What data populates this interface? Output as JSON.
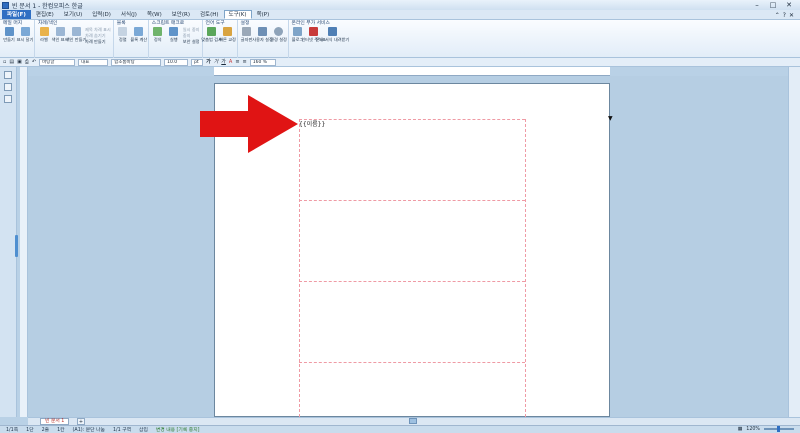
{
  "window": {
    "title": "빈 문서 1 - 한컴오피스 한글",
    "controls": [
      "–",
      "□",
      "✕"
    ]
  },
  "menu": {
    "items": [
      {
        "label": "파일(F)",
        "kind": "file"
      },
      {
        "label": "편집(E)"
      },
      {
        "label": "보기(U)"
      },
      {
        "label": "입력(D)"
      },
      {
        "label": "서식(J)"
      },
      {
        "label": "쪽(W)"
      },
      {
        "label": "보안(R)"
      },
      {
        "label": "검토(H)"
      },
      {
        "label": "도구(K)",
        "kind": "active"
      },
      {
        "label": "쪽(P)"
      }
    ],
    "right": [
      "⌃",
      "?",
      "✕"
    ]
  },
  "ribbon": {
    "groups": [
      {
        "title": "메일 머지",
        "buttons": [
          "만들기",
          "표시 달기"
        ]
      },
      {
        "title": "차례/색인",
        "buttons": [
          "라벨",
          "색인 표시",
          "색인 만들기",
          "차례 만들기"
        ],
        "small": [
          "제목 차례 표시",
          "차례 숨기기"
        ]
      },
      {
        "title": "블록",
        "buttons": [
          "정렬",
          "블록 계산"
        ]
      },
      {
        "title": "스크립트 매크로",
        "buttons": [
          "정의",
          "실행"
        ],
        "small": [
          "일시 중지",
          "중지",
          "보안 설정"
        ]
      },
      {
        "title": "언어 도구",
        "buttons": [
          "맞춤법",
          "사전",
          "맞춤법 검사",
          "빠른 교정"
        ]
      },
      {
        "title": "설정",
        "buttons": [
          "글자판",
          "사용자 설정",
          "환경 설정"
        ]
      },
      {
        "title": "온라인 부가 서비스",
        "buttons": [
          "블로그",
          "인터넷 주석표",
          "문서 서식 내려받기"
        ]
      }
    ]
  },
  "format": {
    "style": "바탕글",
    "font_type": "대표",
    "font": "함초롬바탕",
    "size": "10.0",
    "unit": "pt",
    "line": "160 %",
    "bold": "가",
    "italic": "가",
    "underline": "가"
  },
  "document": {
    "field_text": "{{이름}}",
    "tab_label": "빈 문서 1"
  },
  "status": {
    "items": [
      "1/1쪽",
      "1단",
      "2줄",
      "1칸",
      "(A1): 문단 나눔",
      "1/1 구역",
      "삽입",
      "변경 내용 [기록 중지]"
    ],
    "zoom": "120%"
  }
}
